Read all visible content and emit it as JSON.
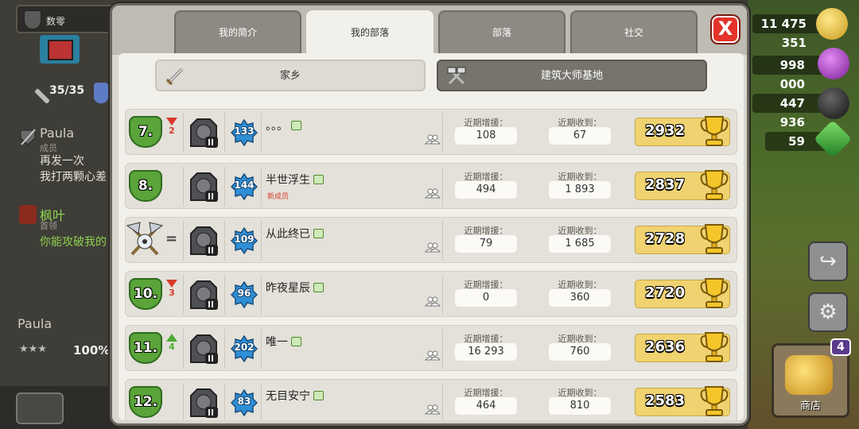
{
  "background": {
    "clan_tag": "数零",
    "troops": "35/35",
    "chat": [
      {
        "name": "Paula",
        "role": "成员",
        "lines": [
          "再发一次",
          "我打两颗心差"
        ]
      },
      {
        "name": "枫叶",
        "role": "首领",
        "lines": [
          "你能攻破我的"
        ]
      }
    ],
    "war_name": "Paula",
    "war_percent": "100%",
    "resources": {
      "gold": "11 475 351",
      "elixir": "998 000",
      "dark_elixir": "447 936",
      "gems": "59"
    },
    "shop_label": "商店",
    "shop_badge": "4"
  },
  "tabs": [
    {
      "label": "我的简介",
      "active": false
    },
    {
      "label": "我的部落",
      "active": true
    },
    {
      "label": "部落",
      "active": false
    },
    {
      "label": "社交",
      "active": false
    }
  ],
  "close_label": "X",
  "sub_tabs": {
    "home": "家乡",
    "builder": "建筑大师基地"
  },
  "stat_labels": {
    "donated": "近期增援：",
    "received": "近期收到："
  },
  "members": [
    {
      "rank": "7.",
      "change_dir": "down",
      "change": "2",
      "level": "133",
      "name": "。。。",
      "role_tag": "",
      "donated": "108",
      "received": "67",
      "trophies": "2932"
    },
    {
      "rank": "8.",
      "change_dir": "",
      "change": "",
      "level": "144",
      "name": "半世浮生",
      "role_tag": "新成员",
      "donated": "494",
      "received": "1 893",
      "trophies": "2837"
    },
    {
      "rank": "",
      "change_dir": "same",
      "change": "=",
      "level": "109",
      "name": "从此终已",
      "role_tag": "",
      "donated": "79",
      "received": "1 685",
      "trophies": "2728"
    },
    {
      "rank": "10.",
      "change_dir": "down",
      "change": "3",
      "level": "96",
      "name": "昨夜星辰",
      "role_tag": "",
      "donated": "0",
      "received": "360",
      "trophies": "2720"
    },
    {
      "rank": "11.",
      "change_dir": "up",
      "change": "4",
      "level": "202",
      "name": "唯一",
      "role_tag": "",
      "donated": "16 293",
      "received": "760",
      "trophies": "2636"
    },
    {
      "rank": "12.",
      "change_dir": "",
      "change": "",
      "level": "83",
      "name": "无目安宁",
      "role_tag": "",
      "donated": "464",
      "received": "810",
      "trophies": "2583"
    }
  ]
}
